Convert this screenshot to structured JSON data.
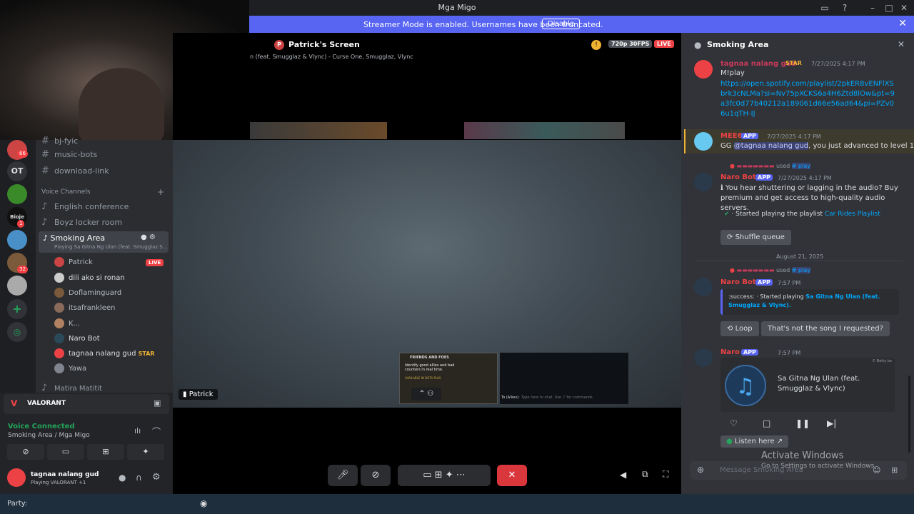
{
  "window": {
    "title": "Mga Migo"
  },
  "banner": {
    "message": "Streamer Mode is enabled. Usernames have been truncated.",
    "button": "Disable"
  },
  "stream": {
    "title": "Patrick's Screen",
    "subtitle": "n (feat. Smugglaz & Vlync) - Curse One, Smugglaz, Vlync",
    "quality": "720p 30FPS",
    "live": "LIVE",
    "owner_label": "Patrick"
  },
  "guilds": [
    {
      "label": "",
      "badge": "66"
    },
    {
      "label": "OT",
      "badge": ""
    },
    {
      "label": "",
      "badge": ""
    },
    {
      "label": "Bioje",
      "badge": "1"
    },
    {
      "label": "",
      "badge": ""
    },
    {
      "label": "",
      "badge": "32"
    },
    {
      "label": "",
      "badge": ""
    }
  ],
  "channels": {
    "text": [
      "bj-fyic",
      "music-bots",
      "download-link"
    ],
    "voice_header": "Voice Channels",
    "voice": [
      "English conference",
      "Boyz locker room"
    ],
    "active": {
      "name": "Smoking Area",
      "activity": "Playing Sa Gitna Ng Ulan (feat. Smugglaz S..."
    },
    "members": [
      {
        "name": "Patrick",
        "live": "LIVE"
      },
      {
        "name": "dili ako si ronan"
      },
      {
        "name": "Doflaminguard"
      },
      {
        "name": "itsafrankleen"
      },
      {
        "name": "K..."
      },
      {
        "name": "Naro Bot"
      },
      {
        "name": "tagnaa nalang gud",
        "tag": "STAR"
      },
      {
        "name": "Yawa"
      }
    ],
    "next": "Matira Matitit"
  },
  "activity_card": {
    "game": "VALORANT"
  },
  "voice_status": {
    "status": "Voice Connected",
    "location": "Smoking Area / Mga Migo"
  },
  "user": {
    "name": "tagnaa nalang gud",
    "status": "Playing VALORANT +1"
  },
  "overlay": {
    "heading": "FRIENDS AND FOES",
    "text": "Identify good allies and bad counters in real time.",
    "sub": "AVAILABLE IN DOTA PLUS",
    "chat_prefix": "To (Allies):",
    "chat_hint": "Type here to chat. Use '/' for commands."
  },
  "chat": {
    "channel": "Smoking Area",
    "messages": [
      {
        "name": "tagnaa nalang gud",
        "tag": "STAR",
        "time": "7/27/2025 4:17 PM",
        "text": "M!play",
        "link": "https://open.spotify.com/playlist/2pkER8vENFlXSbrk3cNLMa?si=Nv75pXCKS6a4H6Ztd8lOw&pt=9a3fc0d77b40212a189061d66e56ad64&pi=PZv06u1qTH-IJ"
      },
      {
        "name": "MEE6",
        "tag": "APP",
        "time": "7/27/2025 4:17 PM",
        "text_pre": "GG ",
        "mention": "@tagnaa nalang gud",
        "text_post": ", you just advanced to level 1!"
      },
      {
        "reply_used": "used",
        "reply_cmd": "# play",
        "name": "Naro Bot",
        "tag": "APP",
        "time": "7/27/2025 4:17 PM",
        "text": "You hear shuttering or lagging in the audio? Buy premium and get access to high-quality audio servers.",
        "embed_pre": "· Started playing the playlist ",
        "embed_link": "Car Rides Playlist",
        "button": "Shuffle queue"
      },
      {
        "divider": "August 21, 2025"
      },
      {
        "reply_used": "used",
        "reply_cmd": "# play",
        "name": "Naro Bot",
        "tag": "APP",
        "time": "7:57 PM",
        "embed_pre": ":success: · Started playing ",
        "embed_link": "Sa Gitna Ng Ulan (feat. Smugglaz & Vlync).",
        "btn1": "Loop",
        "btn2": "That's not the song I requested?"
      },
      {
        "name": "Naro Bot",
        "tag": "APP",
        "time": "7:57 PM",
        "song": "Sa Gitna Ng Ulan (feat. Smugglaz & Vlync)",
        "watermark": "© Betty bo",
        "listen": "Listen here"
      }
    ],
    "input_placeholder": "Message Smoking Area"
  },
  "watermark": {
    "title": "Activate Windows",
    "sub": "Go to Settings to activate Windows."
  },
  "taskbar": {
    "label": "Party:"
  },
  "colors": {
    "accent": "#5865f2",
    "live": "#ed4245",
    "link": "#00a8fc",
    "connected": "#23a55a"
  }
}
